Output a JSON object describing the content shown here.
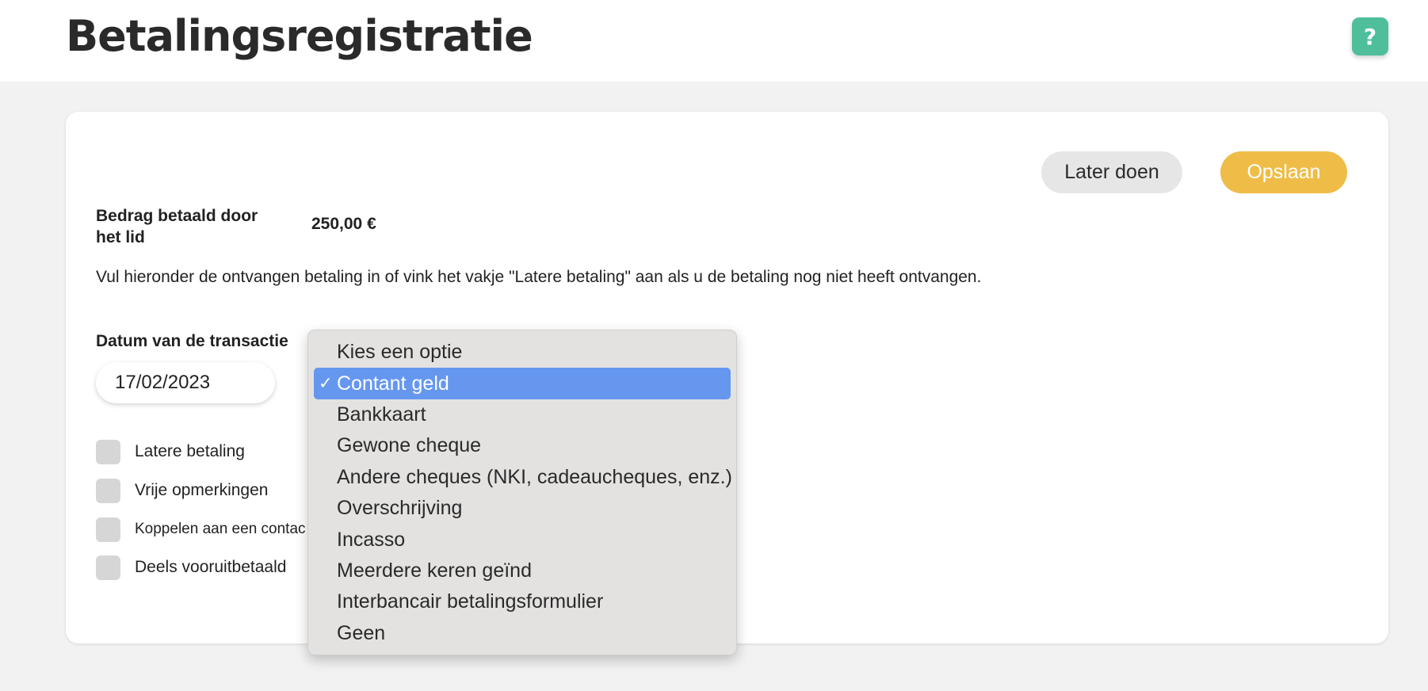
{
  "header": {
    "title": "Betalingsregistratie",
    "help_label": "?"
  },
  "actions": {
    "later_label": "Later doen",
    "save_label": "Opslaan"
  },
  "amount": {
    "label": "Bedrag betaald door het lid",
    "value": "250,00 €"
  },
  "instructions": "Vul hieronder de ontvangen betaling in of vink het vakje \"Latere betaling\" aan als u de betaling nog niet heeft ontvangen.",
  "transaction_date": {
    "label": "Datum van de transactie",
    "value": "17/02/2023"
  },
  "checkboxes": [
    {
      "label": "Latere betaling",
      "checked": false
    },
    {
      "label": "Vrije opmerkingen",
      "checked": false
    },
    {
      "label": "Koppelen aan een contac",
      "checked": false
    },
    {
      "label": "Deels vooruitbetaald",
      "checked": false
    }
  ],
  "payment_method_dropdown": {
    "options": [
      "Kies een optie",
      "Contant geld",
      "Bankkaart",
      "Gewone cheque",
      "Andere cheques (NKI, cadeaucheques, enz.)",
      "Overschrijving",
      "Incasso",
      "Meerdere keren geïnd",
      "Interbancair betalingsformulier",
      "Geen"
    ],
    "selected": "Contant geld",
    "check_mark": "✓"
  },
  "colors": {
    "help_button": "#4fbf9b",
    "save_button": "#efbd47",
    "later_button": "#e6e6e6",
    "dropdown_highlight": "#6597ef"
  },
  "icons": {
    "help": "question-mark-icon",
    "selected_option": "checkmark-icon"
  }
}
